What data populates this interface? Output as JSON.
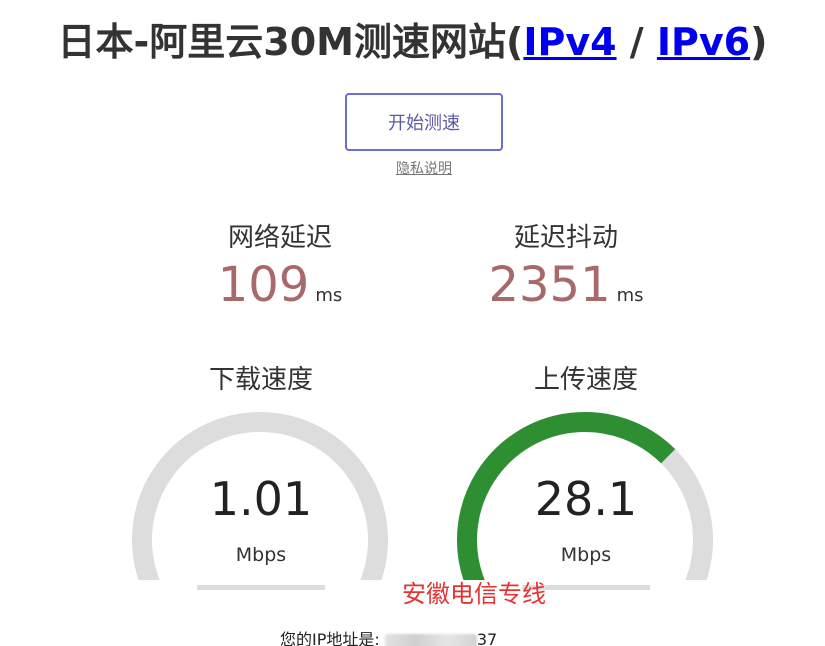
{
  "header": {
    "title_main": "日本-阿里云30M测速网站(",
    "ipv4_link": "IPv4",
    "separator": " / ",
    "ipv6_link": "IPv6",
    "title_end": ")"
  },
  "controls": {
    "start_button": "开始测速",
    "privacy_link": "隐私说明"
  },
  "metrics": {
    "latency": {
      "label": "网络延迟",
      "value": "109",
      "unit": "ms"
    },
    "jitter": {
      "label": "延迟抖动",
      "value": "2351",
      "unit": "ms"
    }
  },
  "gauges": {
    "download": {
      "label": "下载速度",
      "value": "1.01",
      "unit": "Mbps",
      "fraction": 0.036,
      "color": "#6262a8"
    },
    "upload": {
      "label": "上传速度",
      "value": "28.1",
      "unit": "Mbps",
      "fraction": 0.64,
      "color": "#2e8f32"
    },
    "track_color": "#dddddd"
  },
  "annotation": {
    "line_label": "安徽电信专线"
  },
  "ip": {
    "label": "您的IP地址是: ",
    "visible_prefix": "",
    "visible_suffix": "37"
  }
}
